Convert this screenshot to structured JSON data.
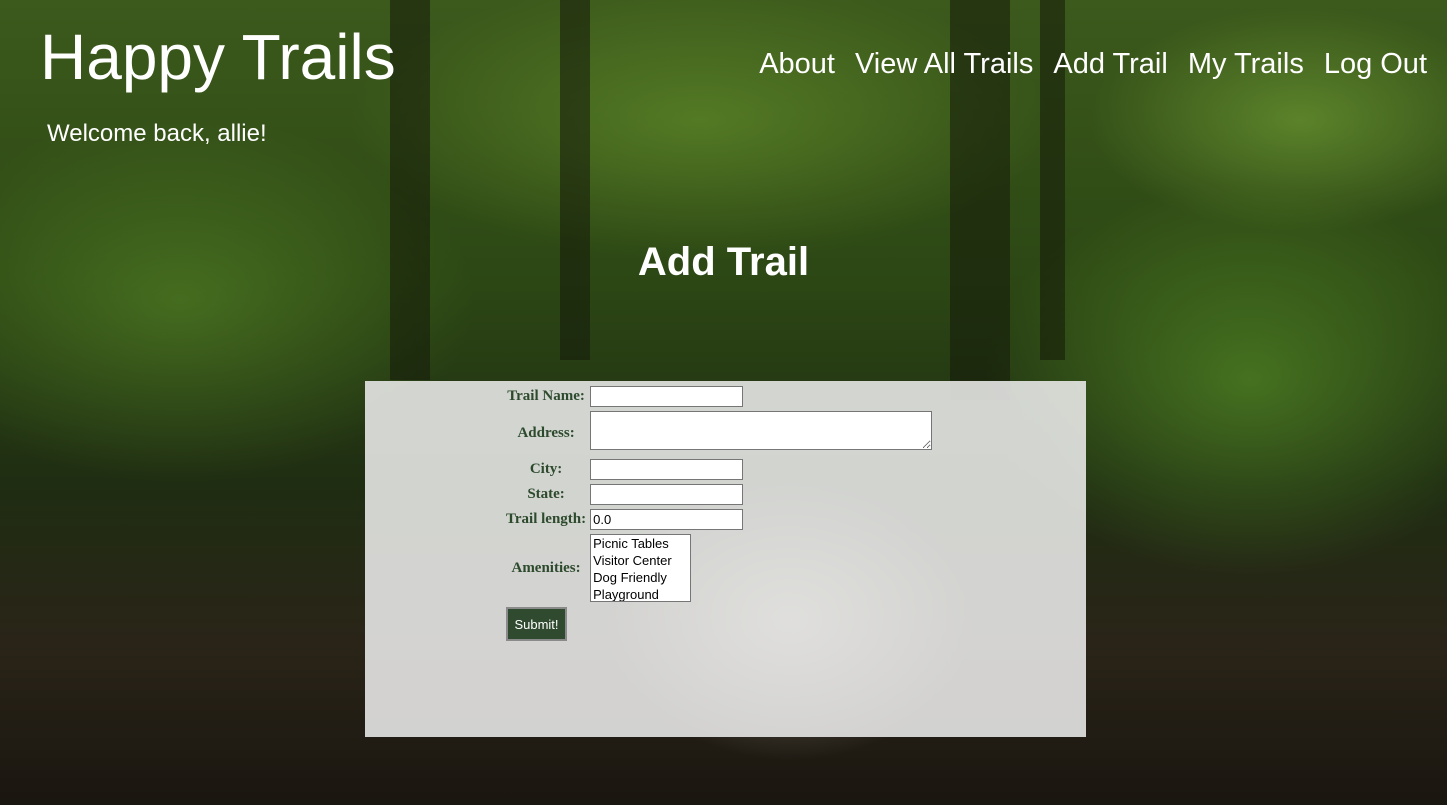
{
  "header": {
    "brand": "Happy Trails",
    "welcome": "Welcome back, allie!"
  },
  "nav": {
    "items": [
      "About",
      "View All Trails",
      "Add Trail",
      "My Trails",
      "Log Out"
    ]
  },
  "page": {
    "title": "Add Trail"
  },
  "form": {
    "trail_name_label": "Trail Name:",
    "trail_name_value": "",
    "address_label": "Address:",
    "address_value": "",
    "city_label": "City:",
    "city_value": "",
    "state_label": "State:",
    "state_value": "",
    "trail_length_label": "Trail length:",
    "trail_length_value": "0.0",
    "amenities_label": "Amenities:",
    "amenities_options": [
      "Picnic Tables",
      "Visitor Center",
      "Dog Friendly",
      "Playground"
    ],
    "submit_label": "Submit!"
  },
  "colors": {
    "label_text": "#2d4a2d",
    "submit_bg": "#2f4a2f",
    "panel_bg": "#f0f0f0"
  }
}
